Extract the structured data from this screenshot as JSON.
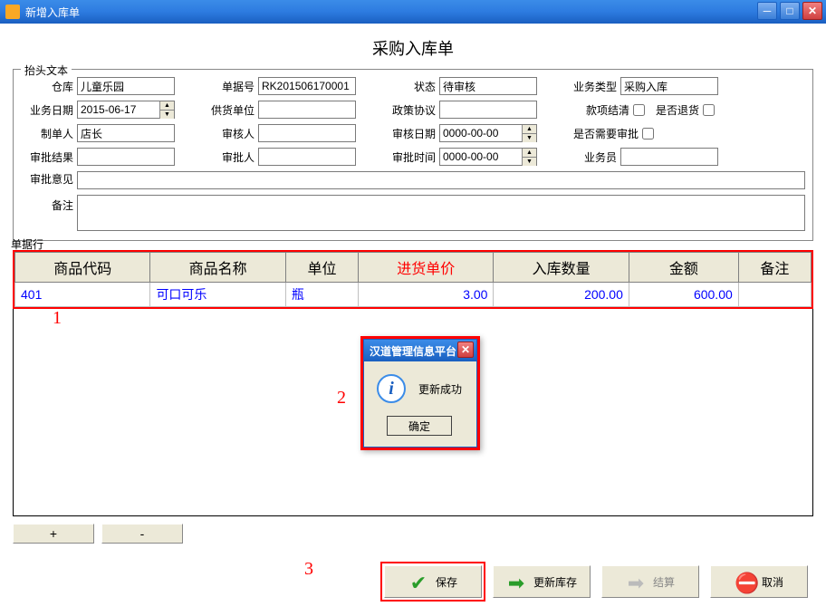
{
  "window": {
    "title": "新增入库单"
  },
  "page_title": "采购入库单",
  "header_legend": "抬头文本",
  "labels": {
    "warehouse": "仓库",
    "doc_no": "单据号",
    "status": "状态",
    "biz_type": "业务类型",
    "biz_date": "业务日期",
    "supplier": "供货单位",
    "policy": "政策协议",
    "pay_settle": "款项结清",
    "is_return": "是否退货",
    "maker": "制单人",
    "checker": "审核人",
    "check_date": "审核日期",
    "need_approve": "是否需要审批",
    "approve_result": "审批结果",
    "approver": "审批人",
    "approve_time": "审批时间",
    "salesman": "业务员",
    "approve_opinion": "审批意见",
    "remark": "备注"
  },
  "values": {
    "warehouse": "儿童乐园",
    "doc_no": "RK201506170001",
    "status": "待审核",
    "biz_type": "采购入库",
    "biz_date": "2015-06-17",
    "supplier": "",
    "policy": "",
    "pay_settle": false,
    "is_return": false,
    "maker": "店长",
    "checker": "",
    "check_date": "0000-00-00",
    "need_approve": false,
    "approve_result": "",
    "approver": "",
    "approve_time": "0000-00-00",
    "salesman": "",
    "approve_opinion": "",
    "remark": ""
  },
  "line_legend": "单据行",
  "columns": [
    "商品代码",
    "商品名称",
    "单位",
    "进货单价",
    "入库数量",
    "金额",
    "备注"
  ],
  "highlight_col_index": 3,
  "rows": [
    {
      "code": "401",
      "name": "可口可乐",
      "unit": "瓶",
      "price": "3.00",
      "qty": "200.00",
      "amount": "600.00",
      "remark": ""
    }
  ],
  "annotations": {
    "a1": "1",
    "a2": "2",
    "a3": "3"
  },
  "dialog": {
    "title": "汉道管理信息平台",
    "message": "更新成功",
    "ok": "确定"
  },
  "pm": {
    "plus": "+",
    "minus": "-"
  },
  "actions": {
    "save": "保存",
    "refresh": "更新库存",
    "settle": "结算",
    "cancel": "取消"
  }
}
